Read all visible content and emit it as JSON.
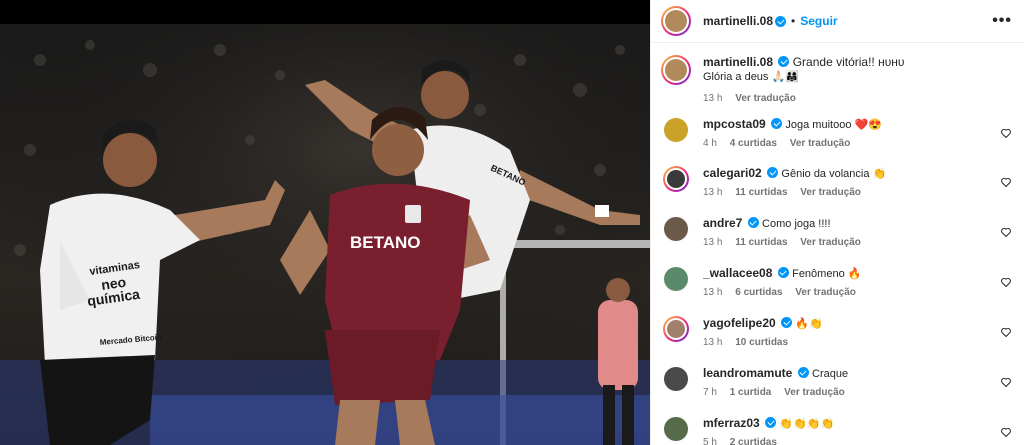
{
  "post": {
    "username": "martinelli.08",
    "follow_label": "Seguir",
    "more_label": "•••",
    "caption_line1": "Grande vitória!! ʜᴜʜᴜ",
    "caption_line2": "Glória a deus 🙏🏻👨‍👩‍👧",
    "caption_time": "13 h",
    "caption_translate": "Ver tradução",
    "photo_texts": {
      "sponsor": "BETANO",
      "vitaminas": "vitaminas",
      "neo": "neo",
      "quimica": "química",
      "betano_small": "BETANO",
      "bahia": "Mercado Bitcoin"
    }
  },
  "comments": [
    {
      "username": "mpcosta09",
      "text": "Joga muitooo ❤️😍",
      "time": "4 h",
      "likes": "4 curtidas",
      "translate": "Ver tradução",
      "avatar_color": "#c9a227"
    },
    {
      "username": "calegari02",
      "text": "Gênio da volancia 👏",
      "time": "13 h",
      "likes": "11 curtidas",
      "translate": "Ver tradução",
      "avatar_color": "#3a3a3a"
    },
    {
      "username": "andre7",
      "text": "Como joga !!!!",
      "time": "13 h",
      "likes": "11 curtidas",
      "translate": "Ver tradução",
      "avatar_color": "#6b5a4a"
    },
    {
      "username": "_wallacee08",
      "text": "Fenômeno 🔥",
      "time": "13 h",
      "likes": "6 curtidas",
      "translate": "Ver tradução",
      "avatar_color": "#5a8a6a"
    },
    {
      "username": "yagofelipe20",
      "text": "🔥👏",
      "time": "13 h",
      "likes": "10 curtidas",
      "translate": "",
      "avatar_color": "#a0806a"
    },
    {
      "username": "leandromamute",
      "text": "Craque",
      "time": "7 h",
      "likes": "1 curtida",
      "translate": "Ver tradução",
      "avatar_color": "#4a4a4a"
    },
    {
      "username": "mferraz03",
      "text": "👏👏👏👏",
      "time": "5 h",
      "likes": "2 curtidas",
      "translate": "",
      "avatar_color": "#556b4a"
    }
  ]
}
